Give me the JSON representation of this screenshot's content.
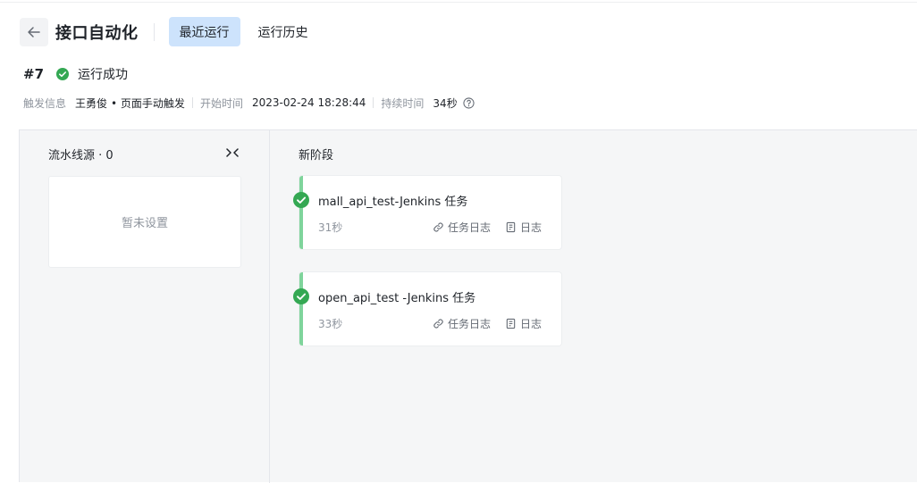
{
  "header": {
    "title": "接口自动化",
    "tabs": [
      {
        "label": "最近运行",
        "active": true
      },
      {
        "label": "运行历史",
        "active": false
      }
    ]
  },
  "run": {
    "number": "#7",
    "status": "运行成功",
    "status_color": "#34a853"
  },
  "meta": {
    "trigger_label": "触发信息",
    "trigger_user": "王勇俊",
    "trigger_type": "• 页面手动触发",
    "start_label": "开始时间",
    "start_time": "2023-02-24 18:28:44",
    "duration_label": "持续时间",
    "duration": "34秒"
  },
  "pipeline": {
    "source_title": "流水线源 · 0",
    "source_empty": "暂未设置",
    "stage_title": "新阶段",
    "jobs": [
      {
        "name": "mall_api_test-Jenkins 任务",
        "duration": "31秒",
        "task_log": "任务日志",
        "log": "日志",
        "status": "success"
      },
      {
        "name": "open_api_test -Jenkins 任务",
        "duration": "33秒",
        "task_log": "任务日志",
        "log": "日志",
        "status": "success"
      }
    ]
  },
  "colors": {
    "accent_tab_bg": "#cde3fc",
    "success": "#34a853",
    "job_accent": "#7fd49b"
  }
}
